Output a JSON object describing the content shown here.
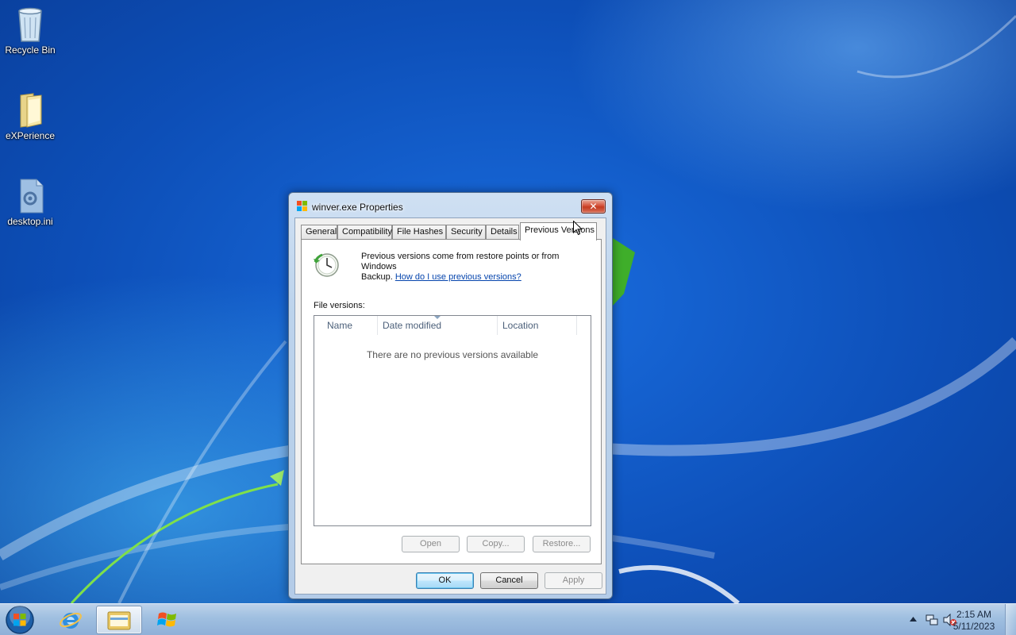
{
  "desktop": {
    "icons": [
      {
        "label": "Recycle Bin",
        "icon": "recycle-bin-icon"
      },
      {
        "label": "eXPerience",
        "icon": "folder-icon"
      },
      {
        "label": "desktop.ini",
        "icon": "config-file-icon"
      }
    ]
  },
  "dialog": {
    "title": "winver.exe Properties",
    "close_glyph": "✕",
    "tabs": [
      "General",
      "Compatibility",
      "File Hashes",
      "Security",
      "Details",
      "Previous Versions"
    ],
    "selected_tab": "Previous Versions",
    "description_line1": "Previous versions come from restore points or from Windows",
    "description_line2": "Backup.",
    "help_link": "How do I use previous versions?",
    "file_versions_label": "File versions:",
    "columns": [
      "Name",
      "Date modified",
      "Location"
    ],
    "empty_message": "There are no previous versions available",
    "panel_buttons": {
      "open": "Open",
      "copy": "Copy...",
      "restore": "Restore..."
    },
    "footer_buttons": {
      "ok": "OK",
      "cancel": "Cancel",
      "apply": "Apply"
    }
  },
  "taskbar": {
    "clock_time": "2:15 AM",
    "clock_date": "5/11/2023"
  },
  "colors": {
    "link": "#0645ad",
    "close_button": "#c43b20",
    "taskbar": "#9fbfe0"
  }
}
